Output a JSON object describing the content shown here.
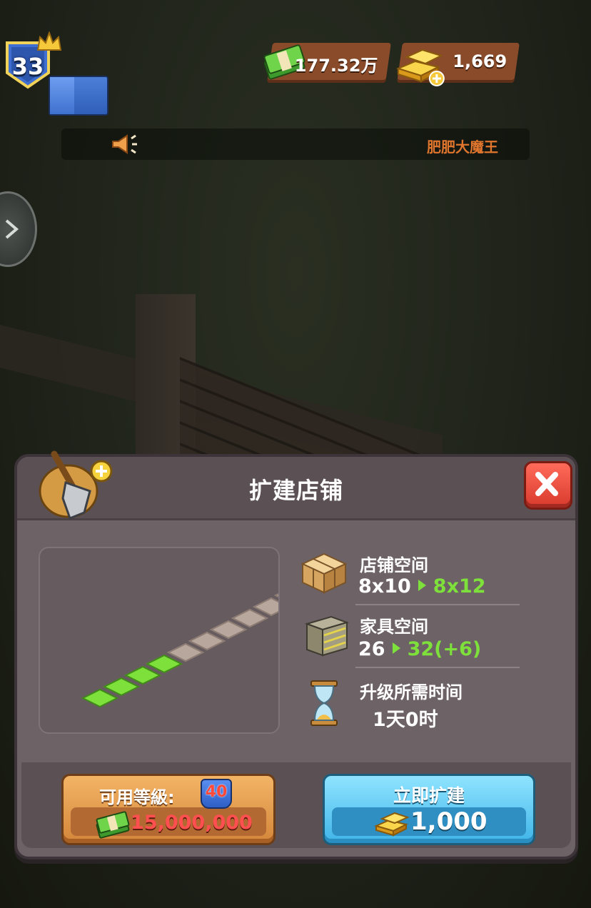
{
  "hud": {
    "level": "33",
    "level_progress": 0.42,
    "cash": "177.32万",
    "gold": "1,669",
    "announcement_name": "肥肥大魔王"
  },
  "dialog": {
    "title": "扩建店铺",
    "shop_space": {
      "label": "店铺空间",
      "from": "8x10",
      "to": "8x12"
    },
    "furniture_space": {
      "label": "家具空间",
      "from": "26",
      "to": "32(+6)"
    },
    "upgrade_time": {
      "label": "升级所需时间",
      "value": "1天0时"
    },
    "level_button": {
      "label": "可用等級:",
      "level": "40",
      "cost": "15,000,000"
    },
    "build_button": {
      "label": "立即扩建",
      "cost": "1,000"
    }
  },
  "icons": [
    "crown-icon",
    "cash-icon",
    "gold-icon",
    "speaker-icon",
    "chevron-right-icon",
    "shovel-icon",
    "close-icon",
    "boxes-icon",
    "crate-icon",
    "hourglass-icon"
  ]
}
